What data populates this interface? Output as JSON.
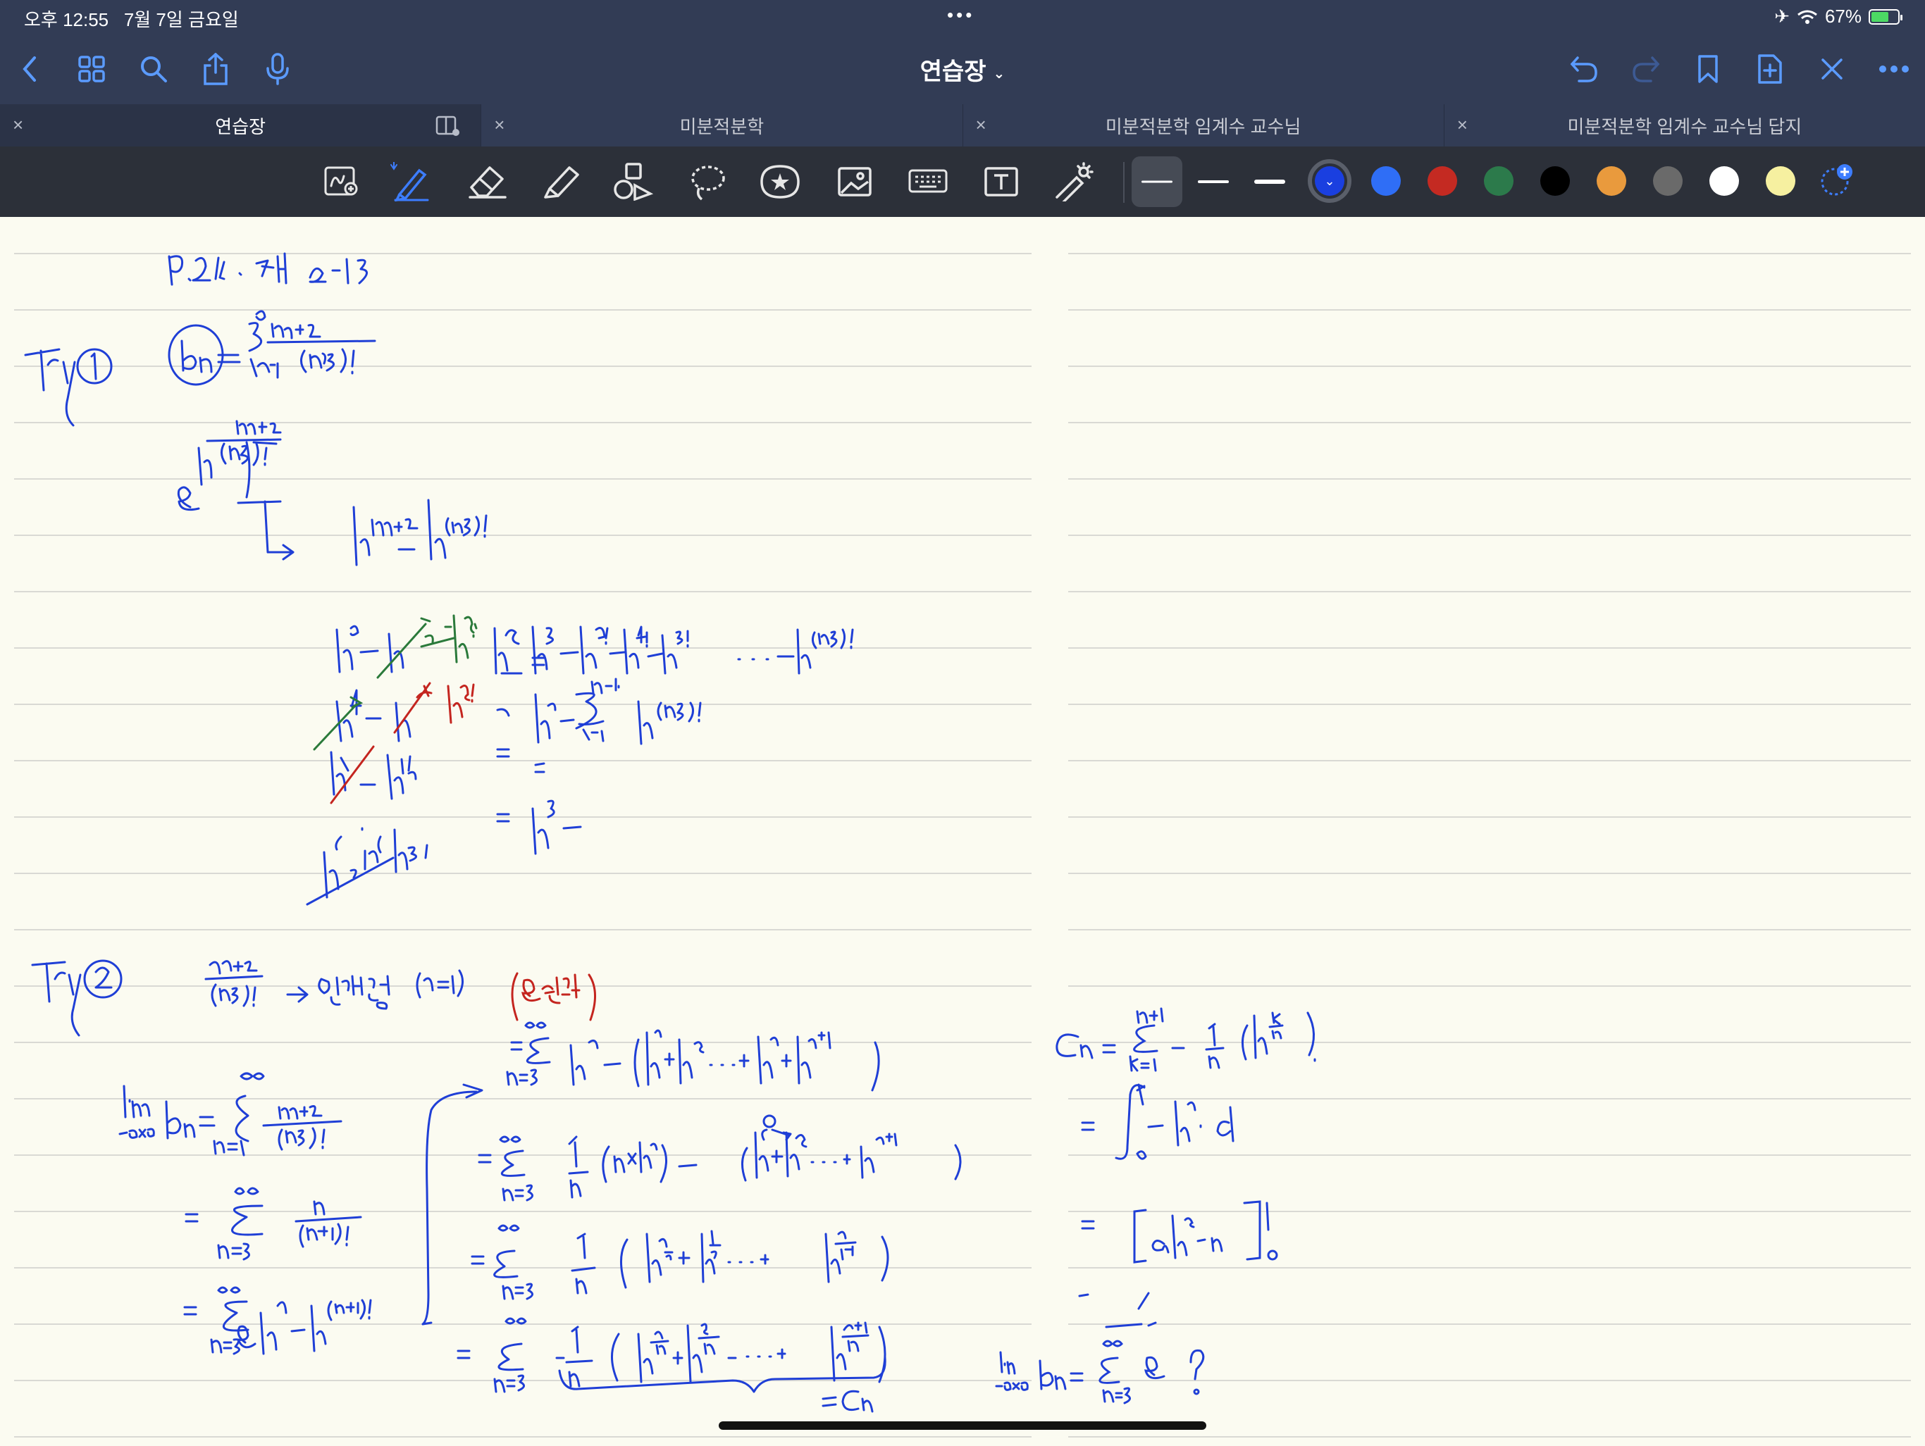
{
  "status": {
    "time": "오후 12:55",
    "date": "7월 7일 금요일",
    "battery": "67%",
    "battery_level": 0.67
  },
  "nav": {
    "title": "연습장",
    "icons": [
      "back-icon",
      "grid-icon",
      "search-icon",
      "share-icon",
      "microphone-icon",
      "undo-icon",
      "redo-icon",
      "bookmark-icon",
      "new-page-icon",
      "close-x-icon",
      "more-icon"
    ]
  },
  "tabs": [
    {
      "label": "연습장",
      "active": true
    },
    {
      "label": "미분적분학",
      "active": false
    },
    {
      "label": "미분적분학 임계수 교수님",
      "active": false
    },
    {
      "label": "미분적분학 임계수 교수님 답지",
      "active": false
    }
  ],
  "toolbar": {
    "tools": [
      "zoom-window-icon",
      "pen-icon",
      "eraser-icon",
      "highlighter-icon",
      "shapes-icon",
      "lasso-icon",
      "sticker-icon",
      "image-icon",
      "keyboard-icon",
      "text-icon",
      "laser-pointer-icon"
    ],
    "selected_tool": "pen",
    "colors": [
      "#1a3fe0",
      "#2f6ef6",
      "#c42a22",
      "#2c7a4b",
      "#000000",
      "#e99a3d",
      "#6a6a6a",
      "#ffffff",
      "#f6f0a0"
    ],
    "selected_color": "#1a3fe0",
    "ink_colors": {
      "blue": "#1f3fd6",
      "green": "#2b7a3b",
      "red": "#c4251f"
    }
  },
  "notes": {
    "header": "p.217. 예제 2-13",
    "try1": "Try ①",
    "try2": "Try ②",
    "mark_a": "e 생각",
    "mark_b": "일반항",
    "mark_c": "(n≥1)",
    "b_n_def": "bₙ = Σ_{n=1}^{∞} (n+2)/(n+3)!",
    "cn_label": "=Cₙ"
  }
}
